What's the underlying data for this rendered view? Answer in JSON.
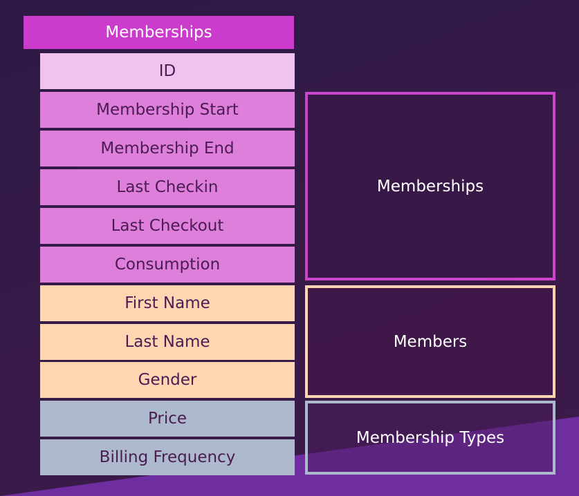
{
  "title": "Memberships",
  "fields": {
    "id": "ID",
    "membership_start": "Membership Start",
    "membership_end": "Membership End",
    "last_checkin": "Last Checkin",
    "last_checkout": "Last Checkout",
    "consumption": "Consumption",
    "first_name": "First Name",
    "last_name": "Last Name",
    "gender": "Gender",
    "price": "Price",
    "billing_frequency": "Billing Frequency"
  },
  "groups": {
    "memberships": "Memberships",
    "members": "Members",
    "membership_types": "Membership Types"
  },
  "colors": {
    "header": "#cc3ccc",
    "id_field": "#f0c3ef",
    "membership_fields": "#de7fdb",
    "member_fields": "#ffd5b2",
    "type_fields": "#adb9cc",
    "background": "#2d1a45",
    "accent_wedge": "#6e2ea0"
  }
}
